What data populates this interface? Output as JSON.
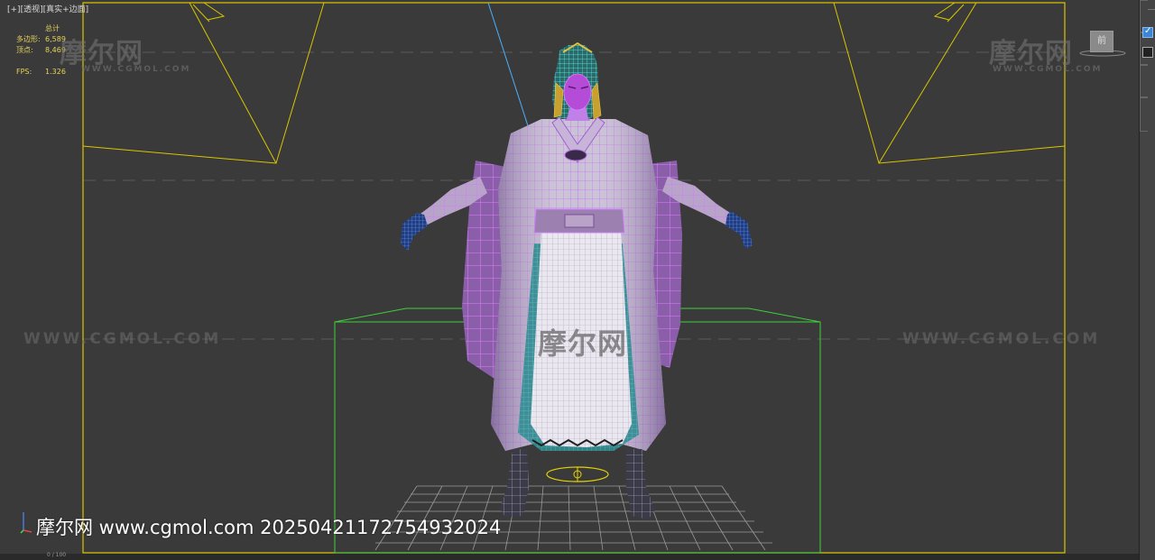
{
  "viewport": {
    "label_parts": [
      "[+]",
      "[透视]",
      "[真实+",
      "边面]"
    ],
    "stats": {
      "title": "总计",
      "polys_label": "多边形:",
      "polys_value": "6,589",
      "verts_label": "顶点:",
      "verts_value": "8,469",
      "fps_label": "FPS:",
      "fps_value": "1.326"
    },
    "viewcube_label": "前",
    "status_text": "0 / 100"
  },
  "watermarks": {
    "logo": "摩尔网",
    "url": "WWW.CGMOL.COM",
    "bottom": "摩尔网 www.cgmol.com 20250421172754932024"
  },
  "colors": {
    "viewport_bg": "#3a3a3a",
    "frame_yellow": "#e6d300",
    "bbox_green": "#3dd13d",
    "wire_magenta": "#d070ff",
    "wire_cyan": "#60e0e0",
    "hair_yellow": "#e0c040"
  },
  "icons": [
    "viewcube-icon",
    "checkbox-icon"
  ]
}
